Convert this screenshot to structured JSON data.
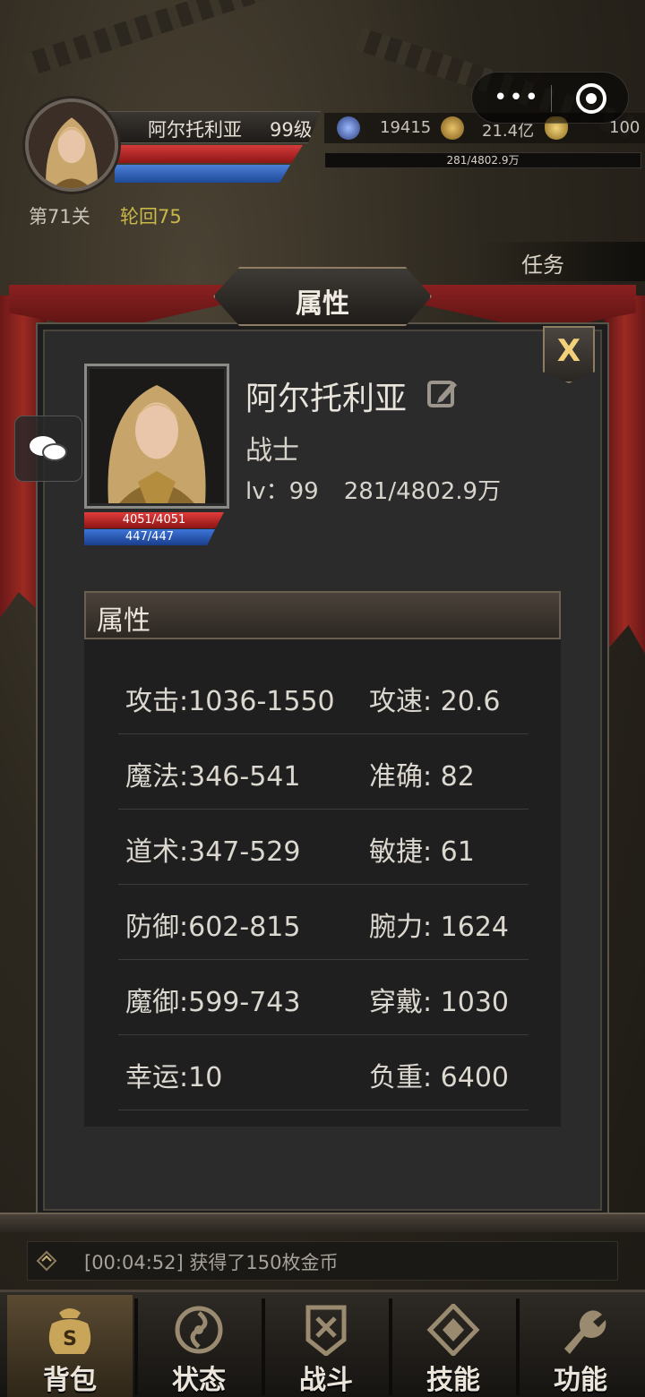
{
  "hud": {
    "player_name": "阿尔托利亚",
    "player_level": "99级",
    "stage": "第71关",
    "reincarnation": "轮回75",
    "resources": {
      "gem": "19415",
      "gold": "21.4亿",
      "ingot": "100"
    },
    "exp_text": "281/4802.9万",
    "task_label": "任务",
    "capsule_more_icon": "more-dots-icon",
    "capsule_close_icon": "target-circle-icon"
  },
  "panel": {
    "title": "属性",
    "close_label": "X",
    "character": {
      "name": "阿尔托利亚",
      "class": "战士",
      "level_label": "lv：99",
      "exp": "281/4802.9万",
      "hp": "4051/4051",
      "mp": "447/447"
    },
    "attributes_header": "属性",
    "attributes": [
      {
        "left": "攻击:1036-1550",
        "right": "攻速: 20.6"
      },
      {
        "left": "魔法:346-541",
        "right": "准确: 82"
      },
      {
        "left": "道术:347-529",
        "right": "敏捷: 61"
      },
      {
        "left": "防御:602-815",
        "right": "腕力: 1624"
      },
      {
        "left": "魔御:599-743",
        "right": "穿戴: 1030"
      },
      {
        "left": "幸运:10",
        "right": "负重: 6400"
      }
    ]
  },
  "message_log": "[00:04:52] 获得了150枚金币",
  "nav": [
    {
      "label": "背包",
      "icon": "bag-icon",
      "active": true
    },
    {
      "label": "状态",
      "icon": "status-icon",
      "active": false
    },
    {
      "label": "战斗",
      "icon": "battle-icon",
      "active": false
    },
    {
      "label": "技能",
      "icon": "skill-icon",
      "active": false
    },
    {
      "label": "功能",
      "icon": "function-icon",
      "active": false
    }
  ],
  "colors": {
    "hp": "#d43b3b",
    "mp": "#3d74d9",
    "reincarnation": "#c8b84a",
    "gold_accent": "#f2d17a"
  }
}
